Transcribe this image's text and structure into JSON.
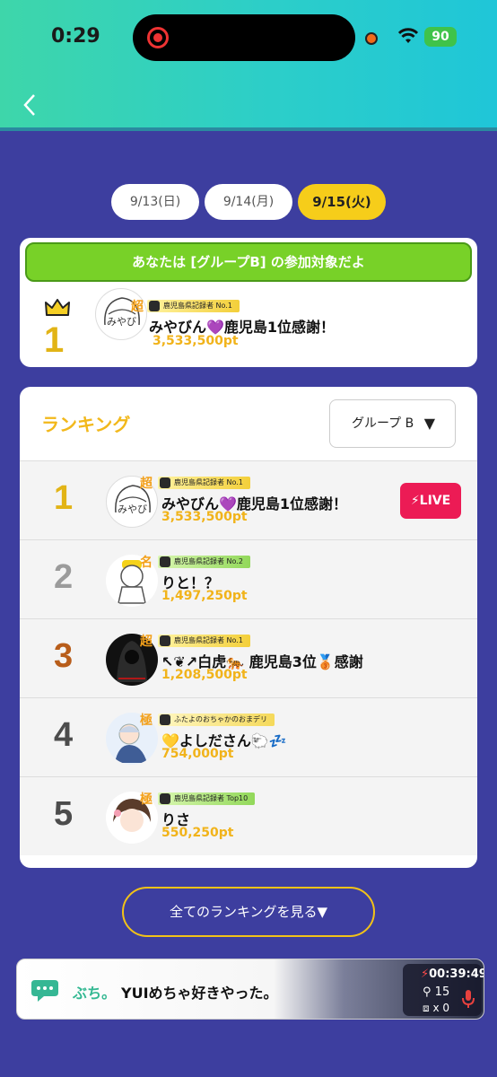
{
  "status_bar": {
    "time": "0:29",
    "battery": "90"
  },
  "date_tabs": [
    {
      "label": "9/13(日)"
    },
    {
      "label": "9/14(月)"
    },
    {
      "label": "9/15(火)"
    }
  ],
  "group_banner": "あなたは [グループB] の参加対象だよ",
  "my_entry": {
    "rank": "1",
    "tier": "超",
    "badge": "鹿児島県記録者 No.1",
    "avatar_text": "みやび",
    "name": "みやびん💜鹿児島1位感謝！",
    "points": "3,533,500pt"
  },
  "ranking": {
    "title": "ランキング",
    "group_select": "グループ B",
    "live_label": "LIVE",
    "items": [
      {
        "rank": "1",
        "tier": "超",
        "badge": "鹿児島県記録者 No.1",
        "avatar_text": "みやび",
        "name": "みやびん💜鹿児島1位感謝！",
        "points": "3,533,500pt"
      },
      {
        "rank": "2",
        "tier": "名",
        "badge": "鹿児島県記録者 No.2",
        "avatar_text": "",
        "name": "りと！？",
        "points": "1,497,250pt"
      },
      {
        "rank": "3",
        "tier": "超",
        "badge": "鹿児島県記録者 No.1",
        "avatar_text": "",
        "name": "↖❦↗白虎🐅 鹿児島3位🥉感謝",
        "points": "1,208,500pt"
      },
      {
        "rank": "4",
        "tier": "極",
        "badge": "ふたよのおちゃかのおまデリ",
        "avatar_text": "",
        "name": "💛よしださん🐑💤",
        "points": "754,000pt"
      },
      {
        "rank": "5",
        "tier": "極",
        "badge": "鹿児島県記録者 Top10",
        "avatar_text": "",
        "name": "りさ",
        "points": "550,250pt"
      }
    ]
  },
  "see_all_label": "全てのランキングを見る▼",
  "live_bar": {
    "user": "ぶち。",
    "message": "YUIめちゃ好きやった。",
    "elapsed": "00:39:49",
    "viewers": "15",
    "gifts": "x 0"
  },
  "colors": {
    "gold": "#e2b416",
    "silver": "#9b9b9b",
    "bronze": "#b85d1a",
    "dark": "#4c4c4c",
    "live": "#ec1b55"
  }
}
